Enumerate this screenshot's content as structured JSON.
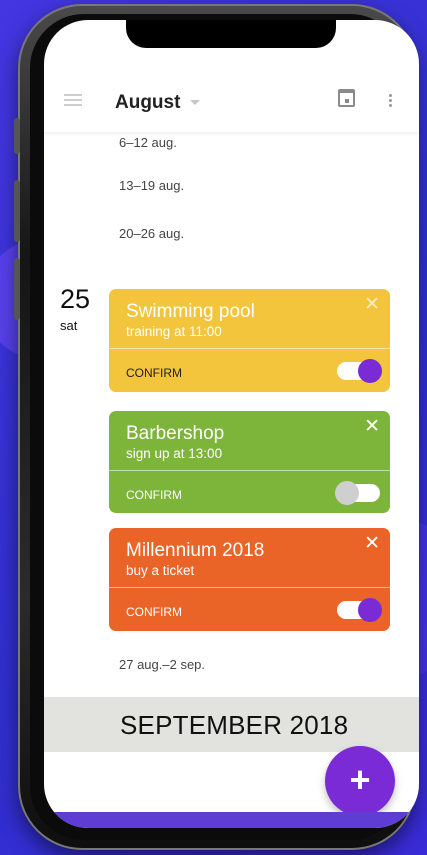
{
  "header": {
    "month": "August"
  },
  "weeks": {
    "w1": "6–12 aug.",
    "w2": "13–19 aug.",
    "w3": "20–26 aug.",
    "w4": "27 aug.–2 sep."
  },
  "day": {
    "number": "25",
    "weekday": "sat"
  },
  "events": [
    {
      "title": "Swimming pool",
      "subtitle": "training at 11:00",
      "confirm": "CONFIRM",
      "confirmed": true,
      "color": "#f2c53d"
    },
    {
      "title": "Barbershop",
      "subtitle": "sign up at 13:00",
      "confirm": "CONFIRM",
      "confirmed": false,
      "color": "#7db43a"
    },
    {
      "title": "Millennium 2018",
      "subtitle": "buy a ticket",
      "confirm": "CONFIRM",
      "confirmed": true,
      "color": "#ea6427"
    }
  ],
  "close_glyph": "✕",
  "next_month": "SEPTEMBER 2018",
  "fab": {
    "label": "+",
    "color": "#7a2bd6"
  },
  "icons": [
    "menu-icon",
    "calendar-icon",
    "more-vertical-icon",
    "close-icon",
    "add-icon"
  ]
}
